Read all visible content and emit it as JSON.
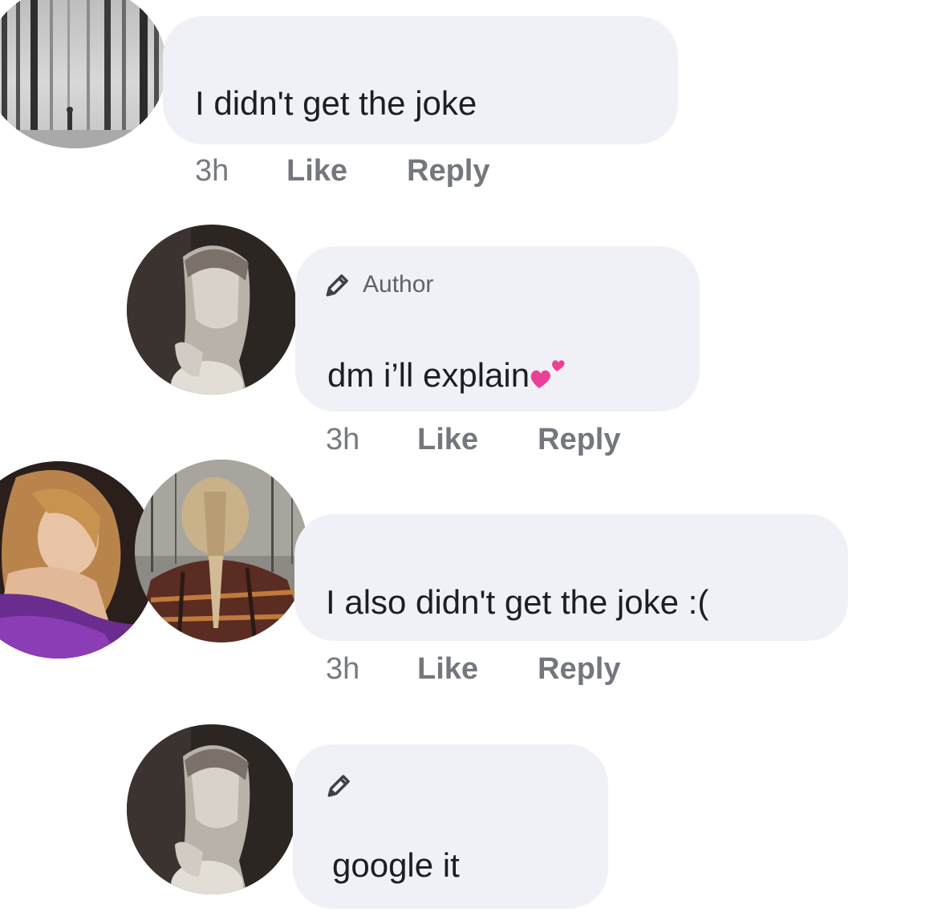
{
  "comments": [
    {
      "text": "I didn't get the joke",
      "time": "3h",
      "like_label": "Like",
      "reply_label": "Reply",
      "avatar": "forest-avatar"
    },
    {
      "badge": "Author",
      "badge_icon": "pencil-icon",
      "text": "dm i’ll explain",
      "emoji": "two-hearts-icon",
      "time": "3h",
      "like_label": "Like",
      "reply_label": "Reply",
      "avatar": "grayscale-portrait-avatar"
    },
    {
      "text": "I also didn't get the joke :(",
      "time": "3h",
      "like_label": "Like",
      "reply_label": "Reply",
      "avatar": "braid-portrait-avatar",
      "secondary_avatar": "purple-portrait-avatar"
    },
    {
      "badge_icon": "pencil-icon",
      "text": "google it",
      "avatar": "grayscale-portrait-avatar"
    }
  ],
  "colors": {
    "bubble": "#f0f1f6",
    "text": "#1c1e21",
    "meta": "#74777d",
    "heart": "#ec3f96"
  }
}
